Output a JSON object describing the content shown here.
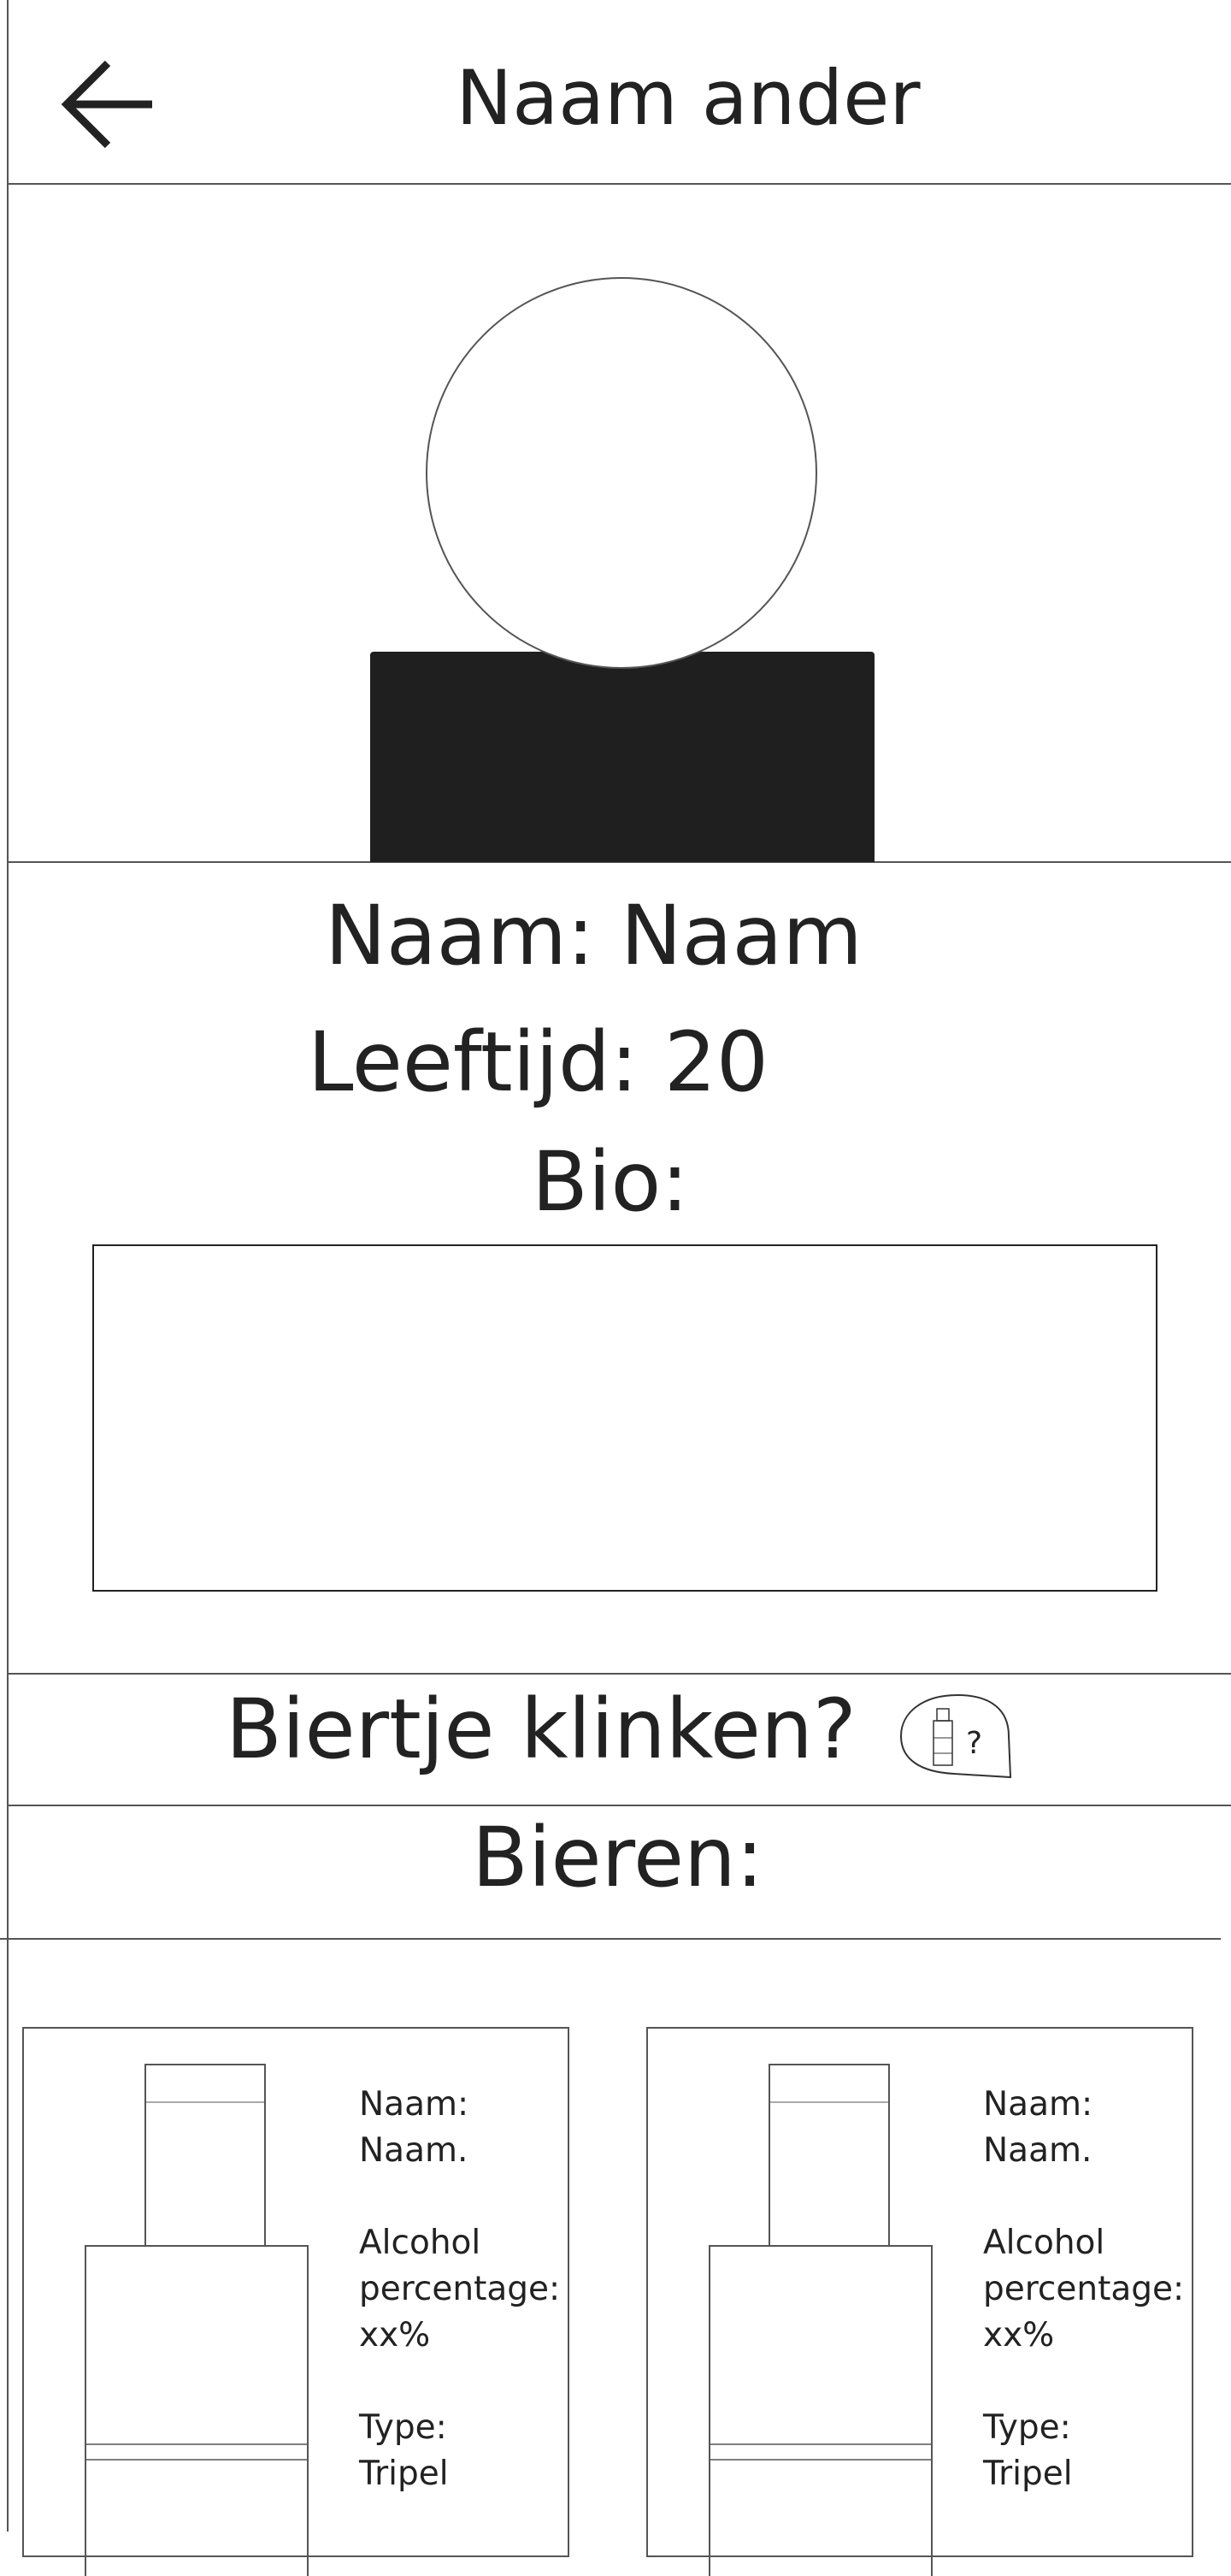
{
  "header": {
    "title": "Naam ander",
    "back_icon": "arrow-left-icon"
  },
  "profile": {
    "avatar_icon": "avatar-placeholder-icon",
    "name_line": "Naam: Naam",
    "age_line": "Leeftijd: 20",
    "bio_label": "Bio:",
    "bio_text": ""
  },
  "cheers": {
    "label": "Biertje klinken?",
    "icon": "beer-bottle-question-icon",
    "icon_glyph": "?"
  },
  "beers": {
    "heading": "Bieren:",
    "items": [
      {
        "name_label": "Naam:",
        "name_value": "Naam.",
        "alcohol_label_1": "Alcohol",
        "alcohol_label_2": "percentage:",
        "alcohol_value": "xx%",
        "type_label": "Type:",
        "type_value": "Tripel",
        "icon": "beer-bottle-icon"
      },
      {
        "name_label": "Naam:",
        "name_value": "Naam.",
        "alcohol_label_1": "Alcohol",
        "alcohol_label_2": "percentage:",
        "alcohol_value": "xx%",
        "type_label": "Type:",
        "type_value": "Tripel",
        "icon": "beer-bottle-icon"
      }
    ]
  }
}
